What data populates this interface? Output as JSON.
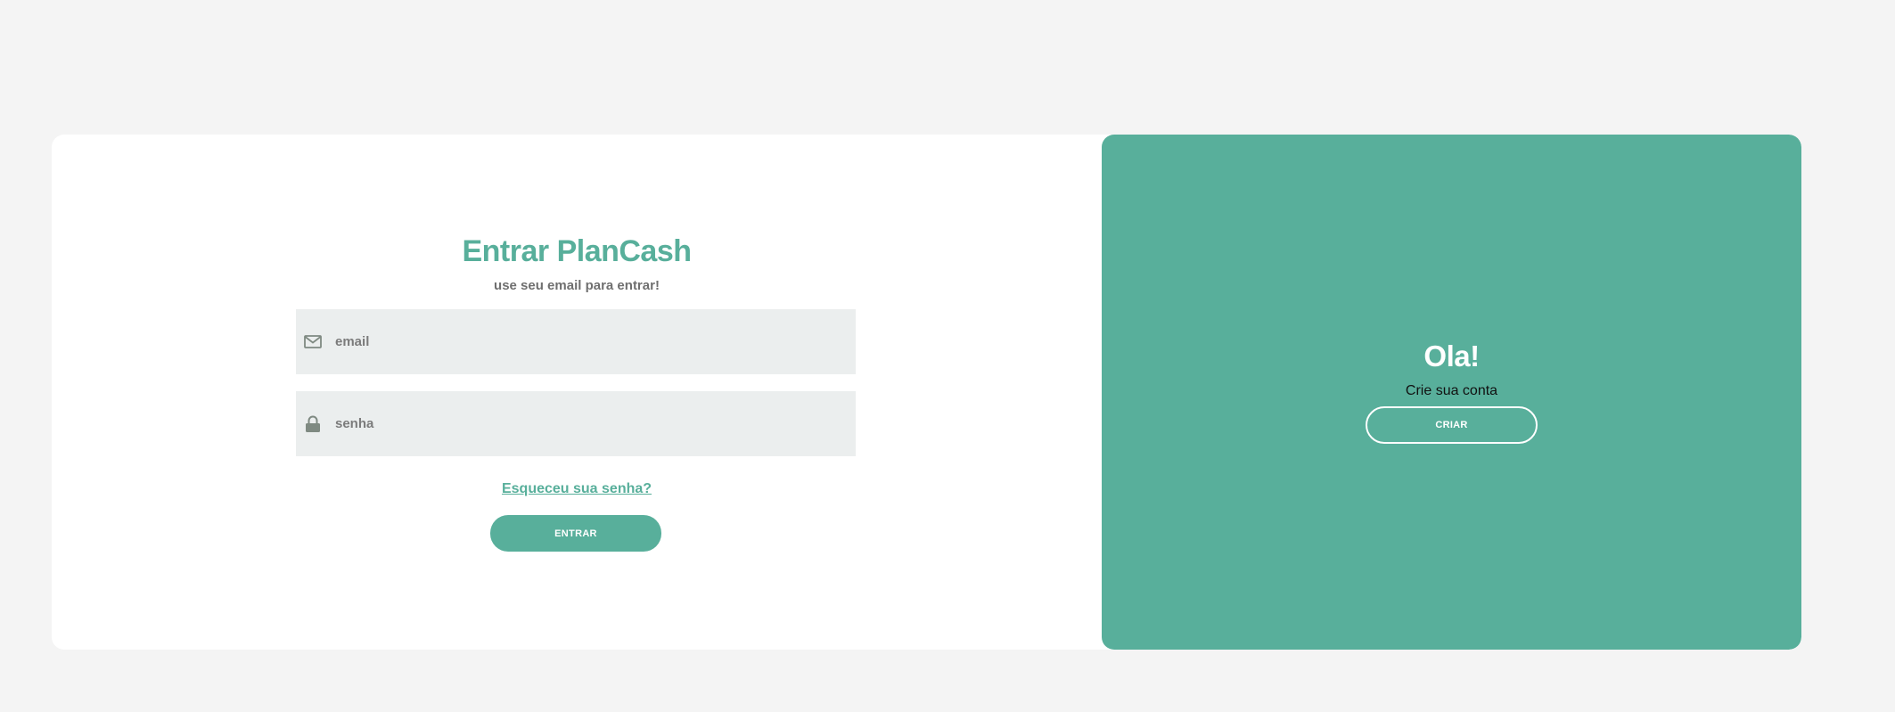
{
  "signin": {
    "title": "Entrar PlanCash",
    "subtitle": "use seu email para entrar!",
    "email": {
      "placeholder": "email",
      "value": "",
      "icon": "envelope-icon"
    },
    "password": {
      "placeholder": "senha",
      "value": "",
      "icon": "lock-icon"
    },
    "forgot_link": "Esqueceu sua senha?",
    "submit_label": "ENTRAR"
  },
  "signup": {
    "heading": "Ola!",
    "text": "Crie sua conta",
    "button_label": "CRIAR"
  },
  "colors": {
    "accent": "#58af9b",
    "page_background": "#f4f4f4",
    "card_background": "#ffffff",
    "input_background": "#ebeeee"
  }
}
